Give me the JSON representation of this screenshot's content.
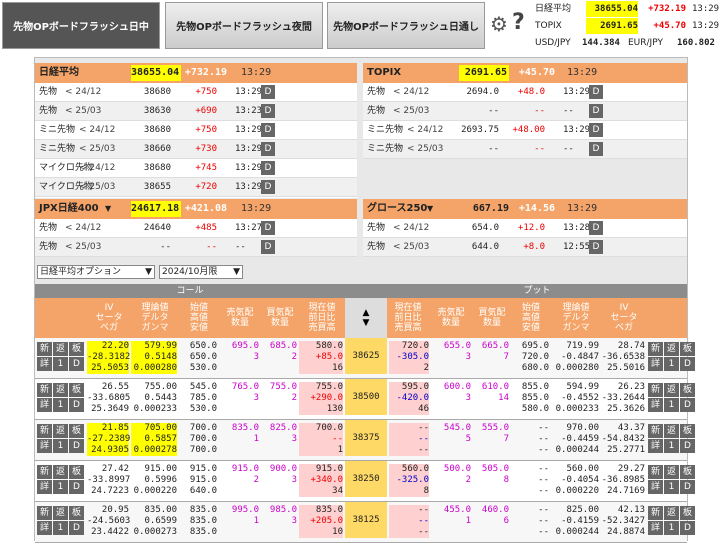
{
  "tabs": [
    "先物OPボードフラッシュ日中",
    "先物OPボードフラッシュ夜間",
    "先物OPボードフラッシュ日通し"
  ],
  "gear_icon": "gear-icon",
  "help_icon": "question-icon",
  "top_quotes": [
    {
      "label": "日経平均",
      "value": "38655.04",
      "change": "+732.19",
      "time": "13:29"
    },
    {
      "label": "TOPIX",
      "value": "2691.65",
      "change": "+45.70",
      "time": "13:29"
    }
  ],
  "fx": {
    "usdjpy_label": "USD/JPY",
    "usdjpy": "144.384",
    "eurjpy_label": "EUR/JPY",
    "eurjpy": "160.802"
  },
  "button_labels": {
    "new": "新",
    "return": "返",
    "board": "板",
    "detail": "詳",
    "one": "1",
    "d": "D"
  },
  "blocks": {
    "nikkei": {
      "name": "日経平均",
      "price": "38655.04",
      "change": "+732.19",
      "time": "13:29",
      "rows": [
        {
          "label": "先物",
          "month": "24/12",
          "price": "38680",
          "change": "+750",
          "time": "13:29"
        },
        {
          "label": "先物",
          "month": "25/03",
          "price": "38630",
          "change": "+690",
          "time": "13:23"
        },
        {
          "label": "ミニ先物",
          "month": "24/12",
          "price": "38680",
          "change": "+750",
          "time": "13:29"
        },
        {
          "label": "ミニ先物",
          "month": "25/03",
          "price": "38660",
          "change": "+730",
          "time": "13:29"
        },
        {
          "label": "マイクロ先物",
          "month": "24/12",
          "price": "38680",
          "change": "+745",
          "time": "13:29"
        },
        {
          "label": "マイクロ先物",
          "month": "25/03",
          "price": "38655",
          "change": "+720",
          "time": "13:29"
        }
      ]
    },
    "topix": {
      "name": "TOPIX",
      "price": "2691.65",
      "change": "+45.70",
      "time": "13:29",
      "rows": [
        {
          "label": "先物",
          "month": "24/12",
          "price": "2694.0",
          "change": "+48.0",
          "time": "13:29"
        },
        {
          "label": "先物",
          "month": "25/03",
          "price": "--",
          "change": "--",
          "time": "--"
        },
        {
          "label": "ミニ先物",
          "month": "24/12",
          "price": "2693.75",
          "change": "+48.00",
          "time": "13:29"
        },
        {
          "label": "ミニ先物",
          "month": "25/03",
          "price": "--",
          "change": "--",
          "time": "--"
        }
      ]
    },
    "jpx": {
      "name": "JPX日経400",
      "price": "24617.18",
      "change": "+421.08",
      "time": "13:29",
      "rows": [
        {
          "label": "先物",
          "month": "24/12",
          "price": "24640",
          "change": "+485",
          "time": "13:27"
        },
        {
          "label": "先物",
          "month": "25/03",
          "price": "--",
          "change": "--",
          "time": "--"
        }
      ]
    },
    "growth": {
      "name": "グロース250",
      "price": "667.19",
      "change": "+14.56",
      "time": "13:29",
      "rows": [
        {
          "label": "先物",
          "month": "24/12",
          "price": "654.0",
          "change": "+12.0",
          "time": "13:28"
        },
        {
          "label": "先物",
          "month": "25/03",
          "price": "644.0",
          "change": "+8.0",
          "time": "12:55"
        }
      ]
    }
  },
  "option_select": {
    "underlying": "日経平均オプション",
    "expiry": "2024/10月限"
  },
  "option_table": {
    "call_label": "コール",
    "put_label": "プット",
    "call_headers": [
      "IV\nセータ\nベガ",
      "理論値\nデルタ\nガンマ",
      "始値\n高値\n安値",
      "売気配\n数量",
      "買気配\n数量",
      "現在値\n前日比\n売買高"
    ],
    "put_headers": [
      "現在値\n前日比\n売買高",
      "売気配\n数量",
      "買気配\n数量",
      "始値\n高値\n安値",
      "理論値\nデルタ\nガンマ",
      "IV\nセータ\nベガ"
    ],
    "rows": [
      {
        "strike": "38625",
        "c_iv": [
          "22.20",
          "-28.3182",
          "25.5053"
        ],
        "c_theo": [
          "579.99",
          "0.5148",
          "0.000280"
        ],
        "c_ohl": [
          "650.0",
          "650.0",
          "530.0"
        ],
        "c_ask": [
          "695.0",
          "3"
        ],
        "c_bid": [
          "685.0",
          "2"
        ],
        "c_last": [
          "580.0",
          "+85.0",
          "16"
        ],
        "p_last": [
          "720.0",
          "-305.0",
          "2"
        ],
        "p_ask": [
          "655.0",
          "3"
        ],
        "p_bid": [
          "665.0",
          "7"
        ],
        "p_ohl": [
          "695.0",
          "720.0",
          "680.0"
        ],
        "p_theo": [
          "719.99",
          "-0.4847",
          "0.000280"
        ],
        "p_iv": [
          "28.74",
          "-36.6538",
          "25.5016"
        ],
        "c_hl": true,
        "p_hl": false
      },
      {
        "strike": "38500",
        "c_iv": [
          "26.55",
          "-33.6805",
          "25.3649"
        ],
        "c_theo": [
          "755.00",
          "0.5443",
          "0.000233"
        ],
        "c_ohl": [
          "545.0",
          "785.0",
          "530.0"
        ],
        "c_ask": [
          "765.0",
          "3"
        ],
        "c_bid": [
          "755.0",
          "2"
        ],
        "c_last": [
          "755.0",
          "+290.0",
          "130"
        ],
        "p_last": [
          "595.0",
          "-420.0",
          "46"
        ],
        "p_ask": [
          "600.0",
          "3"
        ],
        "p_bid": [
          "610.0",
          "14"
        ],
        "p_ohl": [
          "855.0",
          "855.0",
          "580.0"
        ],
        "p_theo": [
          "594.99",
          "-0.4552",
          "0.000233"
        ],
        "p_iv": [
          "26.23",
          "-33.2644",
          "25.3626"
        ],
        "c_hl": false,
        "p_hl": false
      },
      {
        "strike": "38375",
        "c_iv": [
          "21.85",
          "-27.2389",
          "24.9305"
        ],
        "c_theo": [
          "705.00",
          "0.5857",
          "0.000278"
        ],
        "c_ohl": [
          "700.0",
          "700.0",
          "700.0"
        ],
        "c_ask": [
          "835.0",
          "1"
        ],
        "c_bid": [
          "825.0",
          "3"
        ],
        "c_last": [
          "700.0",
          "--",
          "1"
        ],
        "p_last": [
          "--",
          "--",
          "--"
        ],
        "p_ask": [
          "545.0",
          "5"
        ],
        "p_bid": [
          "555.0",
          "7"
        ],
        "p_ohl": [
          "--",
          "--",
          "--"
        ],
        "p_theo": [
          "970.00",
          "-0.4459",
          "0.000244"
        ],
        "p_iv": [
          "43.37",
          "-54.8432",
          "25.2771"
        ],
        "c_hl": true,
        "p_hl": false
      },
      {
        "strike": "38250",
        "c_iv": [
          "27.42",
          "-33.8997",
          "24.7223"
        ],
        "c_theo": [
          "915.00",
          "0.5996",
          "0.000220"
        ],
        "c_ohl": [
          "915.0",
          "915.0",
          "640.0"
        ],
        "c_ask": [
          "915.0",
          "2"
        ],
        "c_bid": [
          "900.0",
          "3"
        ],
        "c_last": [
          "915.0",
          "+340.0",
          "34"
        ],
        "p_last": [
          "560.0",
          "-325.0",
          "8"
        ],
        "p_ask": [
          "500.0",
          "2"
        ],
        "p_bid": [
          "505.0",
          "8"
        ],
        "p_ohl": [
          "--",
          "--",
          "--"
        ],
        "p_theo": [
          "560.00",
          "-0.4054",
          "0.000220"
        ],
        "p_iv": [
          "29.27",
          "-36.8985",
          "24.7169"
        ],
        "c_hl": false,
        "p_hl": false
      },
      {
        "strike": "38125",
        "c_iv": [
          "20.95",
          "-24.5603",
          "23.4422"
        ],
        "c_theo": [
          "835.00",
          "0.6599",
          "0.000273"
        ],
        "c_ohl": [
          "835.0",
          "835.0",
          "835.0"
        ],
        "c_ask": [
          "995.0",
          "1"
        ],
        "c_bid": [
          "985.0",
          "3"
        ],
        "c_last": [
          "835.0",
          "+205.0",
          "10"
        ],
        "p_last": [
          "--",
          "--",
          "--"
        ],
        "p_ask": [
          "455.0",
          "1"
        ],
        "p_bid": [
          "460.0",
          "6"
        ],
        "p_ohl": [
          "--",
          "--",
          "--"
        ],
        "p_theo": [
          "825.00",
          "-0.4159",
          "0.000244"
        ],
        "p_iv": [
          "42.13",
          "-52.3427",
          "24.8874"
        ],
        "c_hl": false,
        "p_hl": false
      }
    ]
  }
}
